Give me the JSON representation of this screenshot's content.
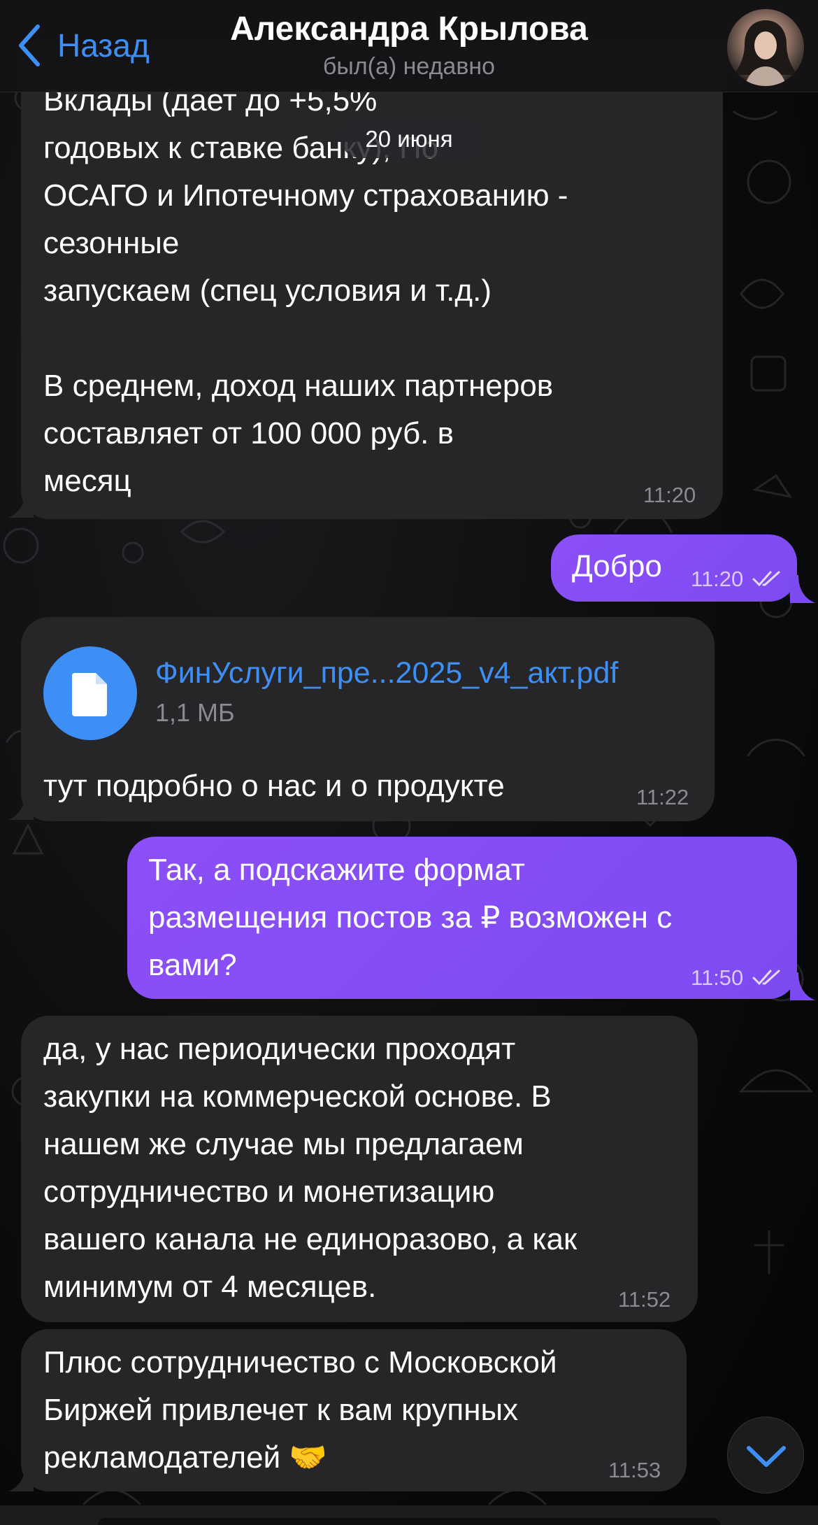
{
  "header": {
    "back_label": "Назад",
    "contact_name": "Александра Крылова",
    "status": "был(а) недавно"
  },
  "date_separator": "20 июня",
  "messages": [
    {
      "direction": "incoming",
      "text": "Вклады (дает до +5,5%\nгодовых к ставке банку), По\nОСАГО и Ипотечному страхованию -\nсезонные\nзапускаем (спец условия и т.д.)\n\nВ среднем, доход наших партнеров\nсоставляет от 100 000 руб. в\nмесяц",
      "time": "11:20"
    },
    {
      "direction": "outgoing",
      "text": "Добро",
      "time": "11:20",
      "read": true
    },
    {
      "direction": "incoming",
      "file": {
        "name": "ФинУслуги_пре...2025_v4_акт.pdf",
        "size": "1,1 МБ"
      },
      "text": "тут подробно о нас и о продукте",
      "time": "11:22"
    },
    {
      "direction": "outgoing",
      "text": "Так, а подскажите формат\nразмещения постов за ₽ возможен с\nвами?",
      "time": "11:50",
      "read": true
    },
    {
      "direction": "incoming",
      "text": "да, у нас периодически проходят\nзакупки на коммерческой основе. В\nнашем же случае мы предлагаем\nсотрудничество и монетизацию\nвашего канала не единоразово, а как\nминимум от 4 месяцев.",
      "time": "11:52"
    },
    {
      "direction": "incoming",
      "text": "Плюс сотрудничество с Московской\nБиржей привлечет к вам крупных\nрекламодателей 🤝",
      "time": "11:53"
    }
  ],
  "icons": {
    "back": "chevron-left-icon",
    "file": "document-icon",
    "scroll_down": "chevron-down-icon",
    "read_receipt": "double-check-icon"
  },
  "colors": {
    "accent": "#3e8ff5",
    "outgoing_bubble": "#8c4ffa",
    "incoming_bubble": "#262628"
  }
}
